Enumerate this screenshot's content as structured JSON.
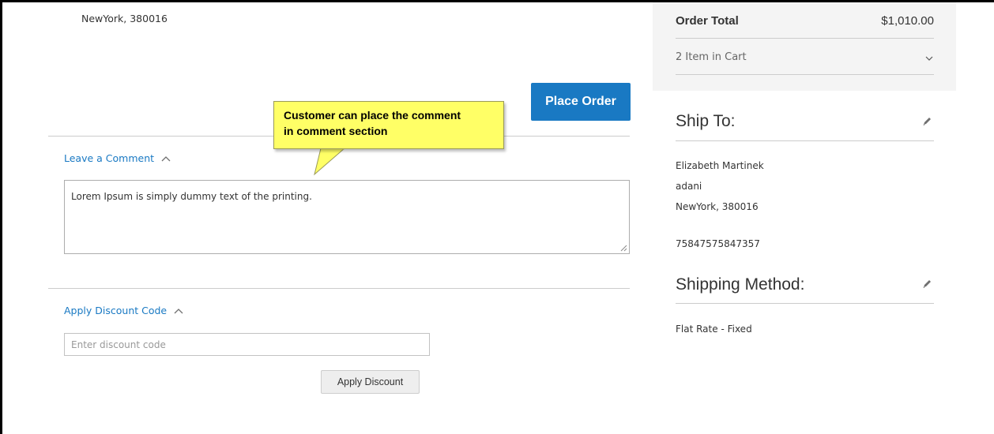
{
  "left": {
    "address_top": "NewYork, 380016",
    "place_order_label": "Place Order",
    "comment": {
      "toggle_label": "Leave a Comment",
      "text": "Lorem Ipsum is simply dummy text of the printing."
    },
    "discount": {
      "toggle_label": "Apply Discount Code",
      "placeholder": "Enter discount code",
      "button_label": "Apply Discount"
    }
  },
  "callout": {
    "line1": "Customer can place the comment",
    "line2": "in comment section"
  },
  "summary": {
    "order_total_label": "Order Total",
    "order_total_value": "$1,010.00",
    "items_in_cart": "2 Item in Cart"
  },
  "ship_to": {
    "title": "Ship To:",
    "name": "Elizabeth Martinek",
    "street": "adani",
    "city_zip": "NewYork, 380016",
    "phone": "75847575847357"
  },
  "shipping_method": {
    "title": "Shipping Method:",
    "value": "Flat Rate - Fixed"
  },
  "colors": {
    "accent": "#1979c3",
    "callout": "#ffff66"
  }
}
